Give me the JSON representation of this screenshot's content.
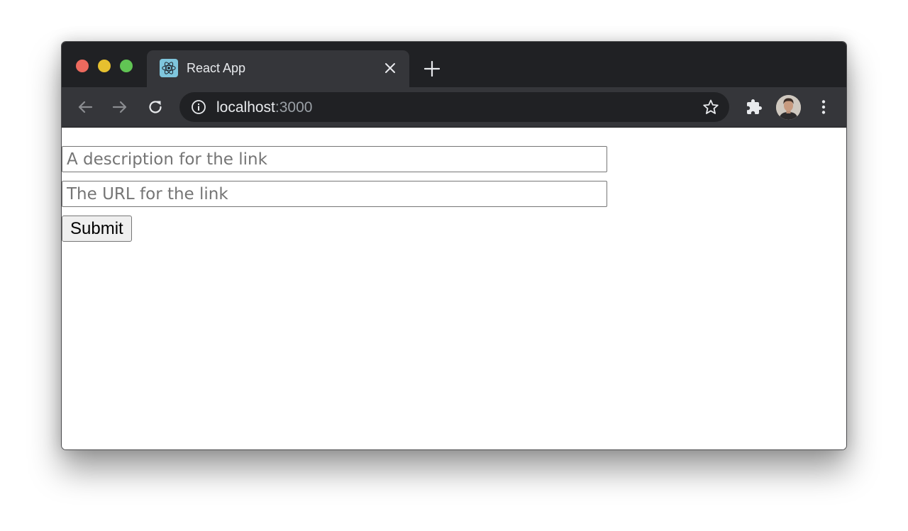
{
  "browser": {
    "tab": {
      "title": "React App",
      "favicon": "react-logo-icon"
    },
    "address": {
      "host": "localhost",
      "port": ":3000"
    },
    "icons": {
      "back": "arrow-left-icon",
      "forward": "arrow-right-icon",
      "reload": "reload-icon",
      "info": "info-icon",
      "bookmark": "star-icon",
      "extensions": "puzzle-icon",
      "menu": "more-vert-icon",
      "close_tab": "close-icon",
      "new_tab": "plus-icon"
    },
    "colors": {
      "titlebar": "#202124",
      "toolbar": "#35363a",
      "traffic_close": "#ed6a5e",
      "traffic_minimize": "#e6c02f",
      "traffic_maximize": "#61c454"
    }
  },
  "form": {
    "description_placeholder": "A description for the link",
    "url_placeholder": "The URL for the link",
    "submit_label": "Submit"
  }
}
